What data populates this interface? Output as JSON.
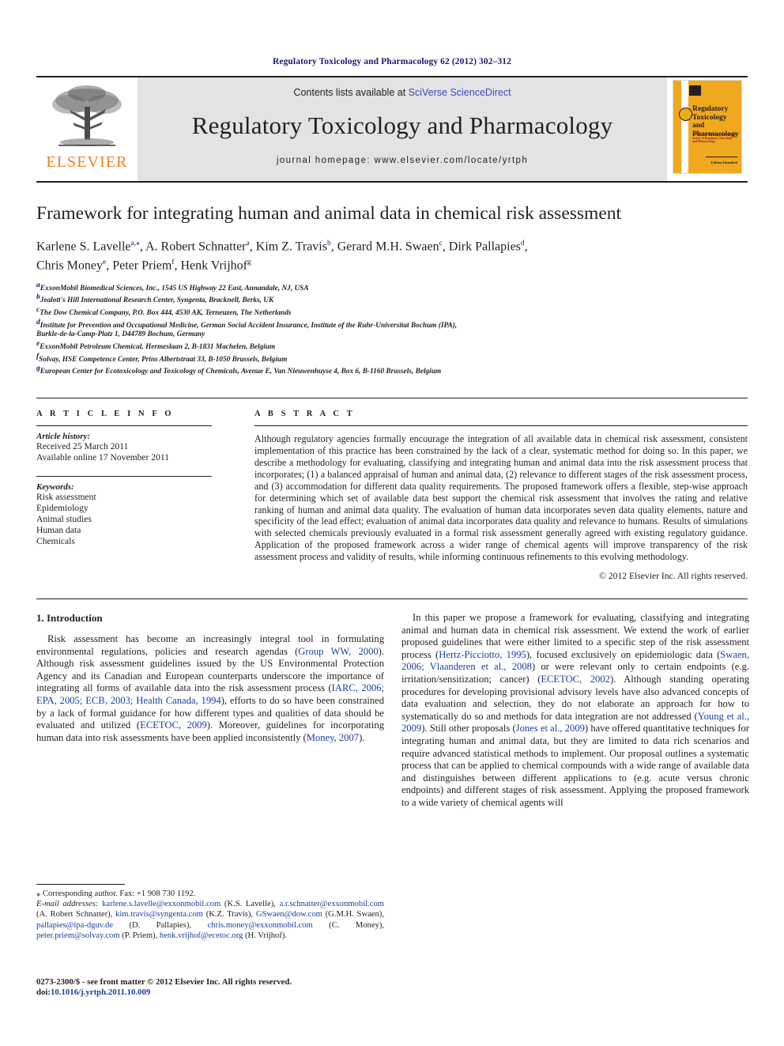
{
  "running_head": "Regulatory Toxicology and Pharmacology 62 (2012) 302–312",
  "masthead": {
    "publisher_logo_text": "ELSEVIER",
    "contents_prefix": "Contents lists available at ",
    "contents_link": "SciVerse ScienceDirect",
    "journal_title": "Regulatory Toxicology and Pharmacology",
    "homepage": "journal homepage: www.elsevier.com/locate/yrtph",
    "cover": {
      "title_line1": "Regulatory",
      "title_line2": "Toxicology and",
      "title_line3": "Pharmacology",
      "subtitle": "Official Journal of the International Society of Regulatory Toxicology and Pharmacology",
      "footer": "Edition Identified"
    },
    "accent_color": "#f08122",
    "link_color": "#3b4cc0",
    "band_color": "#e3e3e3",
    "cover_color": "#f0a81e"
  },
  "article": {
    "title": "Framework for integrating human and animal data in chemical risk assessment",
    "authors_line1": "Karlene S. Lavelle",
    "authors_line1_sup": "a,*",
    "authors": [
      {
        "name": "Karlene S. Lavelle",
        "sup": "a,⁎"
      },
      {
        "name": "A. Robert Schnatter",
        "sup": "a"
      },
      {
        "name": "Kim Z. Travis",
        "sup": "b"
      },
      {
        "name": "Gerard M.H. Swaen",
        "sup": "c"
      },
      {
        "name": "Dirk Pallapies",
        "sup": "d"
      },
      {
        "name": "Chris Money",
        "sup": "e"
      },
      {
        "name": "Peter Priem",
        "sup": "f"
      },
      {
        "name": "Henk Vrijhof",
        "sup": "g"
      }
    ],
    "affiliations": [
      {
        "sup": "a",
        "text": "ExxonMobil Biomedical Sciences, Inc., 1545 US Highway 22 East, Annandale, NJ, USA"
      },
      {
        "sup": "b",
        "text": "Jealott's Hill International Research Center, Syngenta, Bracknell, Berks, UK"
      },
      {
        "sup": "c",
        "text": "The Dow Chemical Company, P.O. Box 444, 4530 AK, Terneuzen, The Netherlands"
      },
      {
        "sup": "d",
        "text": "Institute for Prevention and Occupational Medicine, German Social Accident Insurance, Institute of the Ruhr-Universitat Bochum (IPA),"
      },
      {
        "sup": "",
        "text": "Burkle-de-la-Camp-Platz 1, D44789 Bochum, Germany"
      },
      {
        "sup": "e",
        "text": "ExxonMobil Petroleum Chemical, Hermeslaan 2, B-1831 Machelen, Belgium"
      },
      {
        "sup": "f",
        "text": "Solvay, HSE Competence Center, Prins Albertstraat 33, B-1050 Brussels, Belgium"
      },
      {
        "sup": "g",
        "text": "European Center for Ecotoxicology and Toxicology of Chemicals, Avenue E, Van Nieuwenhuyse 4, Box 6, B-1160 Brussels, Belgium"
      }
    ]
  },
  "article_info": {
    "heading": "A R T I C L E  I N F O",
    "history_label": "Article history:",
    "received": "Received 25 March 2011",
    "available_online": "Available online 17 November 2011",
    "keywords_label": "Keywords:",
    "keywords": [
      "Risk assessment",
      "Epidemiology",
      "Animal studies",
      "Human data",
      "Chemicals"
    ]
  },
  "abstract": {
    "heading": "A B S T R A C T",
    "text": "Although regulatory agencies formally encourage the integration of all available data in chemical risk assessment, consistent implementation of this practice has been constrained by the lack of a clear, systematic method for doing so. In this paper, we describe a methodology for evaluating, classifying and integrating human and animal data into the risk assessment process that incorporates; (1) a balanced appraisal of human and animal data, (2) relevance to different stages of the risk assessment process, and (3) accommodation for different data quality requirements. The proposed framework offers a flexible, step-wise approach for determining which set of available data best support the chemical risk assessment that involves the rating and relative ranking of human and animal data quality. The evaluation of human data incorporates seven data quality elements, nature and specificity of the lead effect; evaluation of animal data incorporates data quality and relevance to humans. Results of simulations with selected chemicals previously evaluated in a formal risk assessment generally agreed with existing regulatory guidance. Application of the proposed framework across a wider range of chemical agents will improve transparency of the risk assessment process and validity of results, while informing continuous refinements to this evolving methodology.",
    "copyright": "© 2012 Elsevier Inc. All rights reserved."
  },
  "body": {
    "section_heading": "1. Introduction",
    "left_paragraph_1_a": "Risk assessment has become an increasingly integral tool in formulating environmental regulations, policies and research agendas (",
    "left_cite_1": "Group WW, 2000",
    "left_paragraph_1_b": "). Although risk assessment guidelines issued by the US Environmental Protection Agency and its Canadian and European counterparts underscore the importance of integrating all forms of available data into the risk assessment process (",
    "left_cite_2": "IARC, 2006; EPA, 2005; ECB, 2003; Health Canada, 1994",
    "left_paragraph_1_c": "), efforts to do so have been constrained by a lack of formal guidance for how different types and qualities of data should be evaluated and utilized (",
    "left_cite_3": "ECETOC, 2009",
    "left_paragraph_1_d": "). Moreover, guidelines for incorporating human data into risk assessments have been applied inconsistently (",
    "left_cite_4": "Money, 2007",
    "left_paragraph_1_e": ").",
    "right_paragraph_1_a": "In this paper we propose a framework for evaluating, classifying and integrating animal and human data in chemical risk assessment. We extend the work of earlier proposed guidelines that were either limited to a specific step of the risk assessment process (",
    "right_cite_1": "Hertz-Picciotto, 1995",
    "right_paragraph_1_b": "), focused exclusively on epidemiologic data (",
    "right_cite_2": "Swaen, 2006; Vlaanderen et al., 2008",
    "right_paragraph_1_c": ") or were relevant only to certain endpoints (e.g. irritation/sensitization; cancer) (",
    "right_cite_3": "ECETOC, 2002",
    "right_paragraph_1_d": "). Although standing operating procedures for developing provisional advisory levels have also advanced concepts of data evaluation and selection, they do not elaborate an approach for how to systematically do so and methods for data integration are not addressed (",
    "right_cite_4": "Young et al., 2009",
    "right_paragraph_1_e": "). Still other proposals (",
    "right_cite_5": "Jones et al., 2009",
    "right_paragraph_1_f": ") have offered quantitative techniques for integrating human and animal data, but they are limited to data rich scenarios and require advanced statistical methods to implement. Our proposal outlines a systematic process that can be applied to chemical compounds with a wide range of available data and distinguishes between different applications to (e.g. acute versus chronic endpoints) and different stages of risk assessment. Applying the proposed framework to a wide variety of chemical agents will"
  },
  "footnotes": {
    "corresponding": "⁎ Corresponding author. Fax: +1 908 730 1192.",
    "email_label": "E-mail addresses:",
    "emails": [
      {
        "addr": "karlene.s.lavelle@exxonmobil.com",
        "who": " (K.S. Lavelle), "
      },
      {
        "addr": "a.r.schnatter@exxonmobil.com",
        "who": " (A. Robert Schnatter), "
      },
      {
        "addr": "kim.travis@syngenta.com",
        "who": " (K.Z. Travis), "
      },
      {
        "addr": "GSwaen@dow.com",
        "who": " (G.M.H. Swaen), "
      },
      {
        "addr": "pallapies@ipa-dguv.de",
        "who": " (D. Pallapies), "
      },
      {
        "addr": "chris.money@exxonmobil.com",
        "who": " (C. Money), "
      },
      {
        "addr": "peter.priem@solvay.com",
        "who": " (P. Priem), "
      },
      {
        "addr": "henk.vrijhof@ecetoc.org",
        "who": " (H. Vrijhof)."
      }
    ],
    "issn_line": "0273-2300/$ - see front matter © 2012 Elsevier Inc. All rights reserved.",
    "doi_label": "doi:",
    "doi": "10.1016/j.yrtph.2011.10.009"
  }
}
